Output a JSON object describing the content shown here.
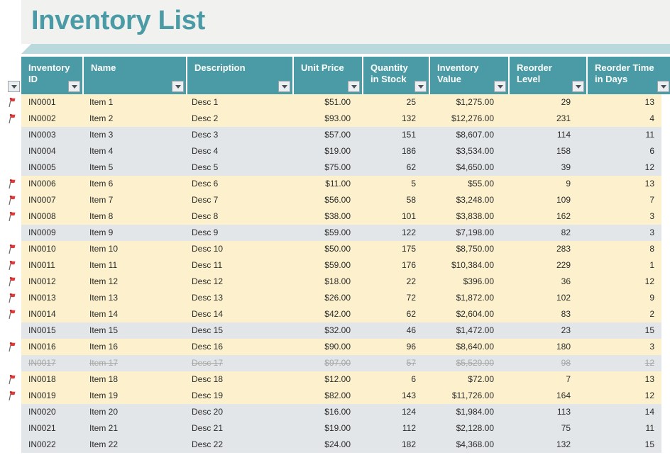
{
  "banner": {
    "title": "Inventory List"
  },
  "colors": {
    "header_teal": "#4a9ba5",
    "banner_bg": "#f1f1ef",
    "strip_teal": "#b9d9dd",
    "flag_row": "#fdf1cd",
    "stripe_gray": "#e3e6e8",
    "title_teal": "#4a9ba5",
    "flag_red": "#e03a3a",
    "struck_text": "#a6a6a6"
  },
  "table": {
    "filter_icon": "chevron-down-icon",
    "flag_icon": "flag-icon",
    "columns": [
      {
        "key": "inventory_id",
        "label": "Inventory ID",
        "align": "left"
      },
      {
        "key": "name",
        "label": "Name",
        "align": "left"
      },
      {
        "key": "description",
        "label": "Description",
        "align": "left"
      },
      {
        "key": "unit_price",
        "label": "Unit Price",
        "align": "right"
      },
      {
        "key": "quantity_in_stock",
        "label": "Quantity in Stock",
        "align": "right"
      },
      {
        "key": "inventory_value",
        "label": "Inventory Value",
        "align": "right"
      },
      {
        "key": "reorder_level",
        "label": "Reorder Level",
        "align": "right"
      },
      {
        "key": "reorder_time_in_days",
        "label": "Reorder Time in Days",
        "align": "right"
      }
    ],
    "rows": [
      {
        "flag": true,
        "struck": false,
        "shade": "flag",
        "inventory_id": "IN0001",
        "name": "Item 1",
        "description": "Desc 1",
        "unit_price": "$51.00",
        "quantity_in_stock": "25",
        "inventory_value": "$1,275.00",
        "reorder_level": "29",
        "reorder_time_in_days": "13"
      },
      {
        "flag": true,
        "struck": false,
        "shade": "flag",
        "inventory_id": "IN0002",
        "name": "Item 2",
        "description": "Desc 2",
        "unit_price": "$93.00",
        "quantity_in_stock": "132",
        "inventory_value": "$12,276.00",
        "reorder_level": "231",
        "reorder_time_in_days": "4"
      },
      {
        "flag": false,
        "struck": false,
        "shade": "gray",
        "inventory_id": "IN0003",
        "name": "Item 3",
        "description": "Desc 3",
        "unit_price": "$57.00",
        "quantity_in_stock": "151",
        "inventory_value": "$8,607.00",
        "reorder_level": "114",
        "reorder_time_in_days": "11"
      },
      {
        "flag": false,
        "struck": false,
        "shade": "gray",
        "inventory_id": "IN0004",
        "name": "Item 4",
        "description": "Desc 4",
        "unit_price": "$19.00",
        "quantity_in_stock": "186",
        "inventory_value": "$3,534.00",
        "reorder_level": "158",
        "reorder_time_in_days": "6"
      },
      {
        "flag": false,
        "struck": false,
        "shade": "gray",
        "inventory_id": "IN0005",
        "name": "Item 5",
        "description": "Desc 5",
        "unit_price": "$75.00",
        "quantity_in_stock": "62",
        "inventory_value": "$4,650.00",
        "reorder_level": "39",
        "reorder_time_in_days": "12"
      },
      {
        "flag": true,
        "struck": false,
        "shade": "flag",
        "inventory_id": "IN0006",
        "name": "Item 6",
        "description": "Desc 6",
        "unit_price": "$11.00",
        "quantity_in_stock": "5",
        "inventory_value": "$55.00",
        "reorder_level": "9",
        "reorder_time_in_days": "13"
      },
      {
        "flag": true,
        "struck": false,
        "shade": "flag",
        "inventory_id": "IN0007",
        "name": "Item 7",
        "description": "Desc 7",
        "unit_price": "$56.00",
        "quantity_in_stock": "58",
        "inventory_value": "$3,248.00",
        "reorder_level": "109",
        "reorder_time_in_days": "7"
      },
      {
        "flag": true,
        "struck": false,
        "shade": "flag",
        "inventory_id": "IN0008",
        "name": "Item 8",
        "description": "Desc 8",
        "unit_price": "$38.00",
        "quantity_in_stock": "101",
        "inventory_value": "$3,838.00",
        "reorder_level": "162",
        "reorder_time_in_days": "3"
      },
      {
        "flag": false,
        "struck": false,
        "shade": "gray",
        "inventory_id": "IN0009",
        "name": "Item 9",
        "description": "Desc 9",
        "unit_price": "$59.00",
        "quantity_in_stock": "122",
        "inventory_value": "$7,198.00",
        "reorder_level": "82",
        "reorder_time_in_days": "3"
      },
      {
        "flag": true,
        "struck": false,
        "shade": "flag",
        "inventory_id": "IN0010",
        "name": "Item 10",
        "description": "Desc 10",
        "unit_price": "$50.00",
        "quantity_in_stock": "175",
        "inventory_value": "$8,750.00",
        "reorder_level": "283",
        "reorder_time_in_days": "8"
      },
      {
        "flag": true,
        "struck": false,
        "shade": "flag",
        "inventory_id": "IN0011",
        "name": "Item 11",
        "description": "Desc 11",
        "unit_price": "$59.00",
        "quantity_in_stock": "176",
        "inventory_value": "$10,384.00",
        "reorder_level": "229",
        "reorder_time_in_days": "1"
      },
      {
        "flag": true,
        "struck": false,
        "shade": "flag",
        "inventory_id": "IN0012",
        "name": "Item 12",
        "description": "Desc 12",
        "unit_price": "$18.00",
        "quantity_in_stock": "22",
        "inventory_value": "$396.00",
        "reorder_level": "36",
        "reorder_time_in_days": "12"
      },
      {
        "flag": true,
        "struck": false,
        "shade": "flag",
        "inventory_id": "IN0013",
        "name": "Item 13",
        "description": "Desc 13",
        "unit_price": "$26.00",
        "quantity_in_stock": "72",
        "inventory_value": "$1,872.00",
        "reorder_level": "102",
        "reorder_time_in_days": "9"
      },
      {
        "flag": true,
        "struck": false,
        "shade": "flag",
        "inventory_id": "IN0014",
        "name": "Item 14",
        "description": "Desc 14",
        "unit_price": "$42.00",
        "quantity_in_stock": "62",
        "inventory_value": "$2,604.00",
        "reorder_level": "83",
        "reorder_time_in_days": "2"
      },
      {
        "flag": false,
        "struck": false,
        "shade": "gray",
        "inventory_id": "IN0015",
        "name": "Item 15",
        "description": "Desc 15",
        "unit_price": "$32.00",
        "quantity_in_stock": "46",
        "inventory_value": "$1,472.00",
        "reorder_level": "23",
        "reorder_time_in_days": "15"
      },
      {
        "flag": true,
        "struck": false,
        "shade": "flag",
        "inventory_id": "IN0016",
        "name": "Item 16",
        "description": "Desc 16",
        "unit_price": "$90.00",
        "quantity_in_stock": "96",
        "inventory_value": "$8,640.00",
        "reorder_level": "180",
        "reorder_time_in_days": "3"
      },
      {
        "flag": false,
        "struck": true,
        "shade": "gray",
        "inventory_id": "IN0017",
        "name": "Item 17",
        "description": "Desc 17",
        "unit_price": "$97.00",
        "quantity_in_stock": "57",
        "inventory_value": "$5,529.00",
        "reorder_level": "98",
        "reorder_time_in_days": "12"
      },
      {
        "flag": true,
        "struck": false,
        "shade": "flag",
        "inventory_id": "IN0018",
        "name": "Item 18",
        "description": "Desc 18",
        "unit_price": "$12.00",
        "quantity_in_stock": "6",
        "inventory_value": "$72.00",
        "reorder_level": "7",
        "reorder_time_in_days": "13"
      },
      {
        "flag": true,
        "struck": false,
        "shade": "flag",
        "inventory_id": "IN0019",
        "name": "Item 19",
        "description": "Desc 19",
        "unit_price": "$82.00",
        "quantity_in_stock": "143",
        "inventory_value": "$11,726.00",
        "reorder_level": "164",
        "reorder_time_in_days": "12"
      },
      {
        "flag": false,
        "struck": false,
        "shade": "gray",
        "inventory_id": "IN0020",
        "name": "Item 20",
        "description": "Desc 20",
        "unit_price": "$16.00",
        "quantity_in_stock": "124",
        "inventory_value": "$1,984.00",
        "reorder_level": "113",
        "reorder_time_in_days": "14"
      },
      {
        "flag": false,
        "struck": false,
        "shade": "gray",
        "inventory_id": "IN0021",
        "name": "Item 21",
        "description": "Desc 21",
        "unit_price": "$19.00",
        "quantity_in_stock": "112",
        "inventory_value": "$2,128.00",
        "reorder_level": "75",
        "reorder_time_in_days": "11"
      },
      {
        "flag": false,
        "struck": false,
        "shade": "gray",
        "inventory_id": "IN0022",
        "name": "Item 22",
        "description": "Desc 22",
        "unit_price": "$24.00",
        "quantity_in_stock": "182",
        "inventory_value": "$4,368.00",
        "reorder_level": "132",
        "reorder_time_in_days": "15"
      }
    ]
  }
}
